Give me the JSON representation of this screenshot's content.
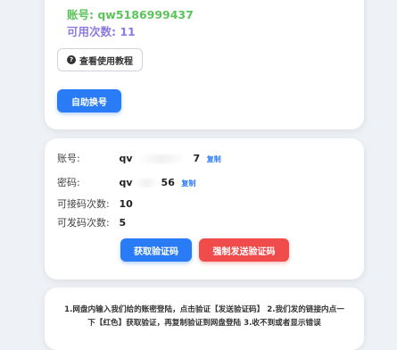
{
  "account_card": {
    "account_label": "账号:",
    "account_value": "qw5186999437",
    "available_label": "可用次数:",
    "available_value": "11",
    "tutorial_button": "查看使用教程",
    "tutorial_icon": "question-circle-icon",
    "self_service_button": "自助换号"
  },
  "credentials_card": {
    "account_label": "账号:",
    "account_prefix": "qv",
    "account_suffix": "7",
    "password_label": "密码:",
    "password_prefix": "qv",
    "password_suffix": "56",
    "copy_label": "复制",
    "receive_label": "可接码次数:",
    "receive_value": "10",
    "send_label": "可发码次数:",
    "send_value": "5",
    "get_code_button": "获取验证码",
    "force_send_button": "强制发送验证码"
  },
  "instructions_card": {
    "text": "1.网盘内输入我们给的账密登陆，点击验证【发送验证码】 2.我们发的链接内点一下【红色】获取验证，再复制验证到网盘登陆 3.收不到或者显示错误"
  },
  "colors": {
    "accent_blue": "#2a7cf6",
    "accent_red": "#f04c4c",
    "account_green": "#5cc45c",
    "available_purple": "#8c7ae6",
    "background": "#eef1f6"
  }
}
